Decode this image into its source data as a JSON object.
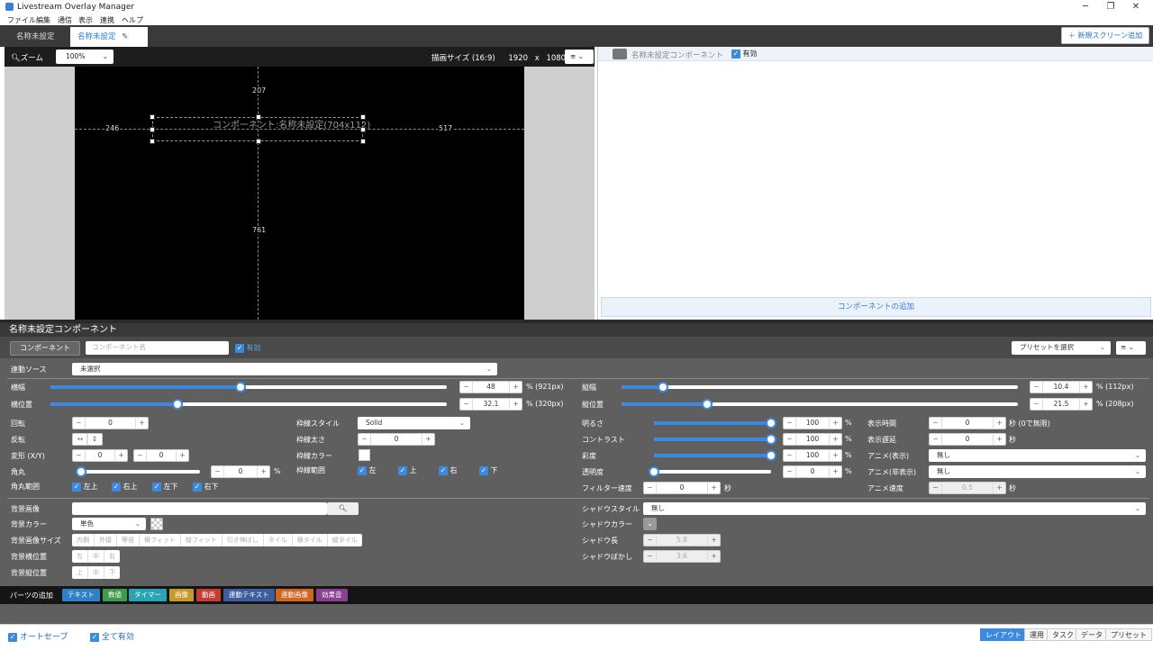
{
  "window": {
    "title": "Livestream Overlay Manager",
    "minimize": "─",
    "maximize": "❐",
    "close": "✕"
  },
  "menu": [
    "ファイル",
    "編集",
    "通信",
    "表示",
    "連携",
    "ヘルプ"
  ],
  "tabs": [
    {
      "label": "名称未設定"
    },
    {
      "label": "名称未設定",
      "edit_icon": "✎",
      "close": "×"
    }
  ],
  "new_screen_button": "＋ 新規スクリーン追加",
  "zoom": {
    "label": "ズーム",
    "value": "100%",
    "chevron": "⌄"
  },
  "draw_size": {
    "label": "描画サイズ (16:9)",
    "width": "1920",
    "x": "x",
    "height": "1080",
    "menu_icon": "≡ ⌄"
  },
  "canvas": {
    "component_label": "コンポーネント:名称未設定(704x112)",
    "top": "207",
    "left": "246",
    "right": "517",
    "bottom": "761"
  },
  "right_panel": {
    "component_name": "名称未設定コンポーネント",
    "valid": "有効",
    "add_button": "コンポーネントの追加"
  },
  "bottom": {
    "title": "名称未設定コンポーネント",
    "component_btn": "コンポーネント",
    "name_placeholder": "コンポーネント名",
    "valid": "有効",
    "preset": "プリセットを選択",
    "source_label": "連動ソース",
    "source_value": "未選択",
    "width": {
      "label": "横幅",
      "value": "48",
      "unit": "% (921px)",
      "pct": 48
    },
    "xpos": {
      "label": "横位置",
      "value": "32.1",
      "unit": "% (320px)",
      "pct": 32.1
    },
    "height": {
      "label": "縦幅",
      "value": "10.4",
      "unit": "% (112px)",
      "pct": 10.4
    },
    "ypos": {
      "label": "縦位置",
      "value": "21.5",
      "unit": "% (208px)",
      "pct": 21.5
    },
    "rotation": {
      "label": "回転",
      "value": "0"
    },
    "flip": {
      "label": "反転",
      "h": "↔",
      "v": "↕"
    },
    "transform": {
      "label": "変形 (X/Y)",
      "x": "0",
      "y": "0"
    },
    "radius": {
      "label": "角丸",
      "value": "0",
      "unit": "%",
      "pct": 0
    },
    "radius_range": {
      "label": "角丸範囲",
      "items": [
        "左上",
        "右上",
        "左下",
        "右下"
      ]
    },
    "border_style": {
      "label": "枠線スタイル",
      "value": "Solid"
    },
    "border_width": {
      "label": "枠線太さ",
      "value": "0"
    },
    "border_color": {
      "label": "枠線カラー"
    },
    "border_range": {
      "label": "枠線範囲",
      "items": [
        "左",
        "上",
        "右",
        "下"
      ]
    },
    "brightness": {
      "label": "明るさ",
      "value": "100",
      "unit": "%",
      "pct": 100
    },
    "contrast": {
      "label": "コントラスト",
      "value": "100",
      "unit": "%",
      "pct": 100
    },
    "saturation": {
      "label": "彩度",
      "value": "100",
      "unit": "%",
      "pct": 100
    },
    "opacity": {
      "label": "透明度",
      "value": "0",
      "unit": "%",
      "pct": 0
    },
    "filter_speed": {
      "label": "フィルター速度",
      "value": "0",
      "unit": "秒"
    },
    "display_time": {
      "label": "表示時間",
      "value": "0",
      "unit": "秒 (0で無限)"
    },
    "display_delay": {
      "label": "表示遅延",
      "value": "0",
      "unit": "秒"
    },
    "anim_show": {
      "label": "アニメ(表示)",
      "value": "無し"
    },
    "anim_hide": {
      "label": "アニメ(非表示)",
      "value": "無し"
    },
    "anim_speed": {
      "label": "アニメ速度",
      "value": "0.5",
      "unit": "秒"
    },
    "bg_image": {
      "label": "背景画像"
    },
    "bg_color": {
      "label": "背景カラー",
      "value": "単色"
    },
    "bg_size": {
      "label": "背景画像サイズ",
      "options": [
        "内側",
        "外接",
        "等倍",
        "横フィット",
        "縦フィット",
        "引き伸ばし",
        "タイル",
        "横タイル",
        "縦タイル"
      ]
    },
    "bg_hpos": {
      "label": "背景横位置",
      "options": [
        "左",
        "中",
        "右"
      ]
    },
    "bg_vpos": {
      "label": "背景縦位置",
      "options": [
        "上",
        "中",
        "下"
      ]
    },
    "shadow_style": {
      "label": "シャドウスタイル",
      "value": "無し"
    },
    "shadow_color": {
      "label": "シャドウカラー"
    },
    "shadow_length": {
      "label": "シャドウ長",
      "value": "5.8"
    },
    "shadow_blur": {
      "label": "シャドウぼかし",
      "value": "3.6"
    }
  },
  "parts": {
    "label": "パーツの追加",
    "buttons": [
      {
        "label": "テキスト",
        "color": "#2f7fc9"
      },
      {
        "label": "数値",
        "color": "#3f9a4a"
      },
      {
        "label": "タイマー",
        "color": "#2aa3b5"
      },
      {
        "label": "画像",
        "color": "#c59a2a"
      },
      {
        "label": "動画",
        "color": "#c63b32"
      },
      {
        "label": "連動テキスト",
        "color": "#3d5d9e"
      },
      {
        "label": "連動画像",
        "color": "#d0661f"
      },
      {
        "label": "効果音",
        "color": "#8a3f8f"
      }
    ]
  },
  "footer": {
    "autosave": "オートセーブ",
    "all_valid": "全て有効",
    "tabs": [
      "レイアウト",
      "運用",
      "タスク",
      "データ",
      "プリセット"
    ]
  }
}
